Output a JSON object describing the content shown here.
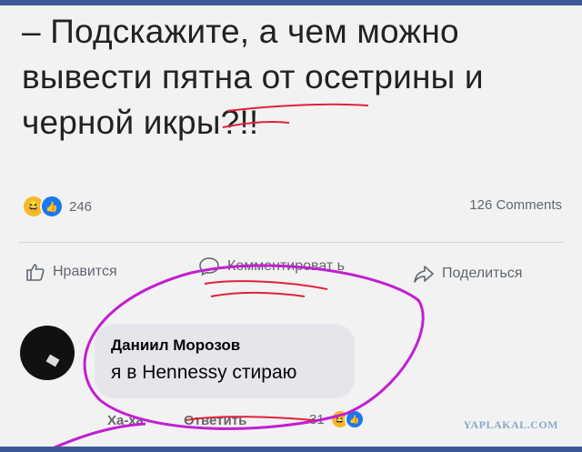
{
  "post": {
    "text": "– Подскажите, а чем можно вывести пятна от осетрины и черной икры?!!"
  },
  "stats": {
    "reaction_icons": [
      "haha-icon",
      "like-icon"
    ],
    "reaction_count": "246",
    "comments_count": "126 Comments"
  },
  "actions": {
    "like_label": "Нравится",
    "comment_label": "Комментироват ь",
    "share_label": "Поделиться"
  },
  "comment": {
    "author": "Даниил Морозов",
    "text": "я в Hennessy стираю",
    "haha_label": "Ха-ха",
    "reply_label": "Ответить",
    "reaction_count": "31"
  },
  "watermark": "YAPLAKAL.COM",
  "colors": {
    "facebook_blue": "#3b5998",
    "bubble_bg": "#e4e6eb",
    "annotation_purple": "#c21fd1",
    "annotation_red": "#e0223a"
  }
}
